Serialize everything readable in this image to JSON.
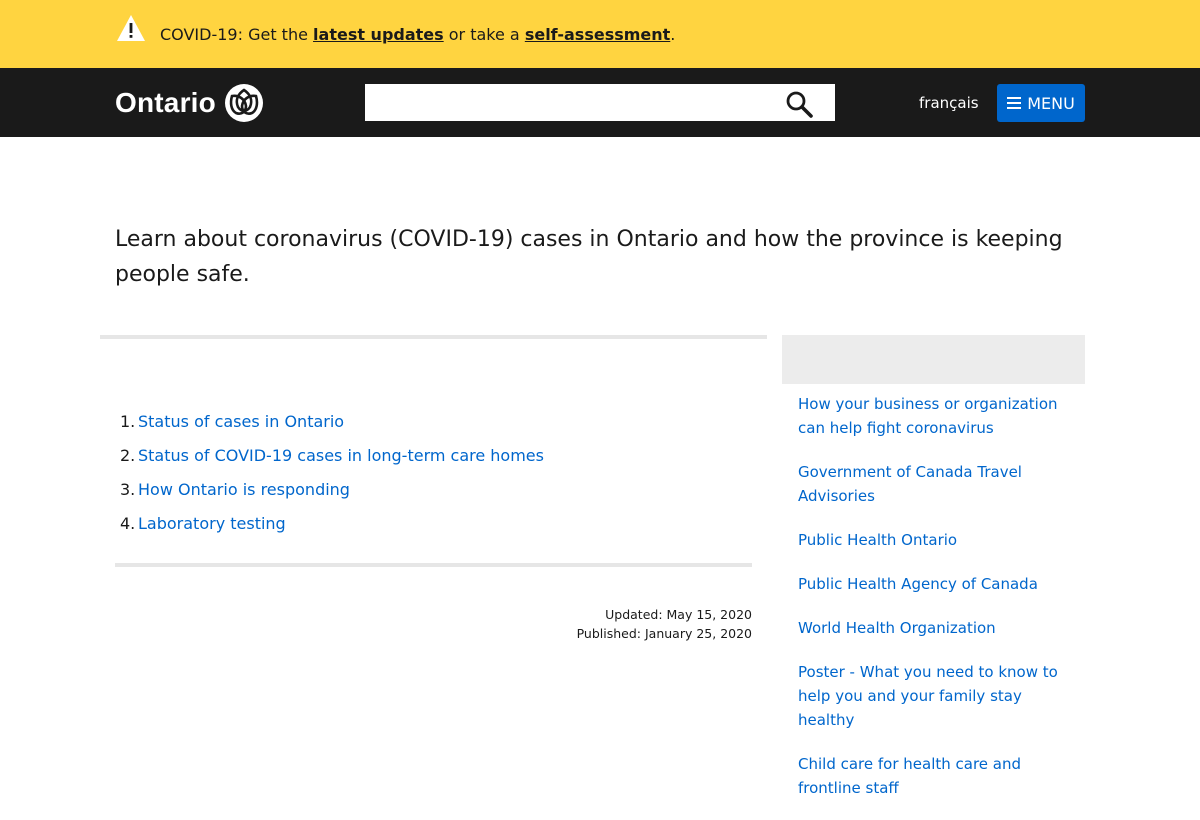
{
  "banner": {
    "prefix": "COVID-19: Get the ",
    "link1": "latest updates",
    "middle": " or take a ",
    "link2": "self-assessment",
    "suffix": ".",
    "icon": "warning-icon"
  },
  "header": {
    "logo_text": "Ontario",
    "search_placeholder": "",
    "search_value": "",
    "language_link": "français",
    "menu_label": "MENU"
  },
  "intro": "Learn about coronavirus (COVID-19) cases in Ontario and how the province is keeping people safe.",
  "toc": [
    {
      "num": "1.",
      "label": "Status of cases in Ontario"
    },
    {
      "num": "2.",
      "label": "Status of COVID-19 cases in long-term care homes"
    },
    {
      "num": "3.",
      "label": "How Ontario is responding"
    },
    {
      "num": "4.",
      "label": "Laboratory testing"
    }
  ],
  "dates": {
    "updated": "Updated: May 15, 2020",
    "published": "Published: January 25, 2020"
  },
  "sidebar": {
    "links": [
      "How your business or organization can help fight coronavirus",
      "Government of Canada Travel Advisories",
      "Public Health Ontario",
      "Public Health Agency of Canada",
      "World Health Organization",
      "Poster - What you need to know to help you and your family stay healthy",
      "Child care for health care and frontline staff"
    ]
  },
  "colors": {
    "banner_bg": "#ffd440",
    "header_bg": "#1a1a1a",
    "link": "#0066cc",
    "menu_button": "#0066cc"
  }
}
